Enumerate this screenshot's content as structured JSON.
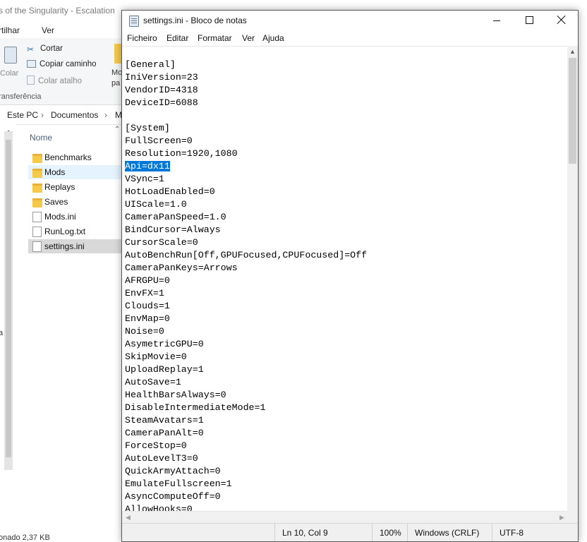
{
  "explorer": {
    "title": "s of the Singularity - Escalation",
    "menu": [
      "rtilhar",
      "Ver"
    ],
    "ribbon": {
      "paste_label": "Colar",
      "cut_label": "Cortar",
      "copy_path_label": "Copiar caminho",
      "paste_shortcut_label": "Colar atalho",
      "move_label": "Mo",
      "move_label2": "pa",
      "group_label": "ransferência"
    },
    "breadcrumb": [
      "Este PC",
      "Documentos",
      "M"
    ],
    "list_header": "Nome",
    "files": [
      {
        "name": "Benchmarks",
        "kind": "folder"
      },
      {
        "name": "Mods",
        "kind": "folder"
      },
      {
        "name": "Replays",
        "kind": "folder"
      },
      {
        "name": "Saves",
        "kind": "folder"
      },
      {
        "name": "Mods.ini",
        "kind": "ini"
      },
      {
        "name": "RunLog.txt",
        "kind": "txt"
      },
      {
        "name": "settings.ini",
        "kind": "ini"
      }
    ],
    "status": "onado 2,37 KB",
    "side_chars": [
      "a",
      "l"
    ]
  },
  "notepad": {
    "title": "settings.ini - Bloco de notas",
    "menu": [
      "Ficheiro",
      "Editar",
      "Formatar",
      "Ver",
      "Ajuda"
    ],
    "lines": [
      "[General]",
      "IniVersion=23",
      "VendorID=4318",
      "DeviceID=6088",
      "",
      "[System]",
      "FullScreen=0",
      "Resolution=1920,1080",
      "Api=dx11",
      "VSync=1",
      "HotLoadEnabled=0",
      "UIScale=1.0",
      "CameraPanSpeed=1.0",
      "BindCursor=Always",
      "CursorScale=0",
      "AutoBenchRun[Off,GPUFocused,CPUFocused]=Off",
      "CameraPanKeys=Arrows",
      "AFRGPU=0",
      "EnvFX=1",
      "Clouds=1",
      "EnvMap=0",
      "Noise=0",
      "AsymetricGPU=0",
      "SkipMovie=0",
      "UploadReplay=1",
      "AutoSave=1",
      "HealthBarsAlways=0",
      "DisableIntermediateMode=1",
      "SteamAvatars=1",
      "CameraPanAlt=0",
      "ForceStop=0",
      "AutoLevelT3=0",
      "QuickArmyAttach=0",
      "EmulateFullscreen=1",
      "AsyncComputeOff=0",
      "AllowHooks=0"
    ],
    "selected_line_index": 8,
    "status": {
      "position": "Ln 10, Col 9",
      "zoom": "100%",
      "line_endings": "Windows (CRLF)",
      "encoding": "UTF-8"
    }
  },
  "colors": {
    "selection": "#0078d7",
    "status_bar_bg": "#f0f0f0",
    "hover_row": "#e5f3ff",
    "selected_row": "#d9d9d9"
  }
}
